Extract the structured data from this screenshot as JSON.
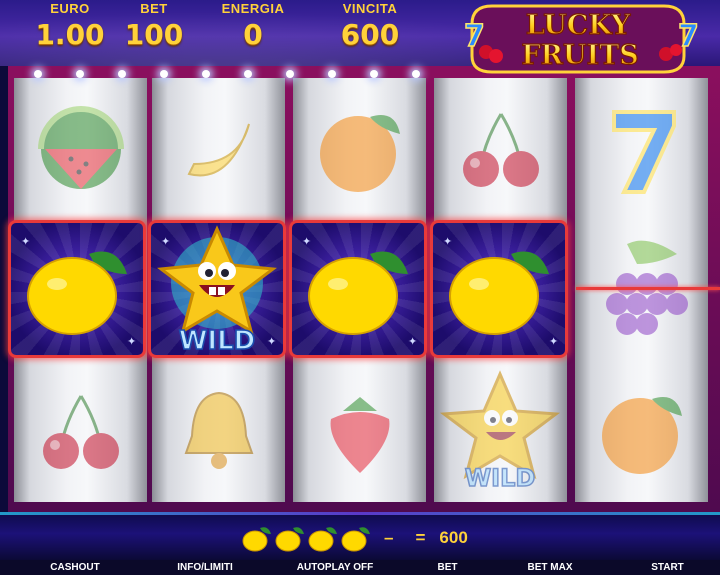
{
  "meters": {
    "euro": {
      "label": "EURO",
      "value": "1.00"
    },
    "bet": {
      "label": "BET",
      "value": "100"
    },
    "energia": {
      "label": "ENERGIA",
      "value": "0"
    },
    "vincita": {
      "label": "VINCITA",
      "value": "600"
    }
  },
  "logo": {
    "line1": "LUCKY",
    "line2": "FRUITS"
  },
  "reels": [
    [
      "watermelon",
      "lemon",
      "cherries"
    ],
    [
      "banana",
      "wild",
      "bell"
    ],
    [
      "orange",
      "lemon",
      "strawberry"
    ],
    [
      "cherries",
      "lemon",
      "wild"
    ],
    [
      "seven",
      "grapes",
      "orange"
    ]
  ],
  "wild_label": "WILD",
  "win_line": {
    "symbol": "lemon",
    "count": 4,
    "dash": "–",
    "equals": "=",
    "amount": "600"
  },
  "buttons": [
    "CASHOUT",
    "INFO/LIMITI",
    "AUTOPLAY OFF",
    "BET",
    "BET MAX",
    "START"
  ],
  "colors": {
    "accent_gold": "#ffd23a",
    "payline_red": "#e83a3a",
    "win_bg": "#3b1f9e"
  }
}
